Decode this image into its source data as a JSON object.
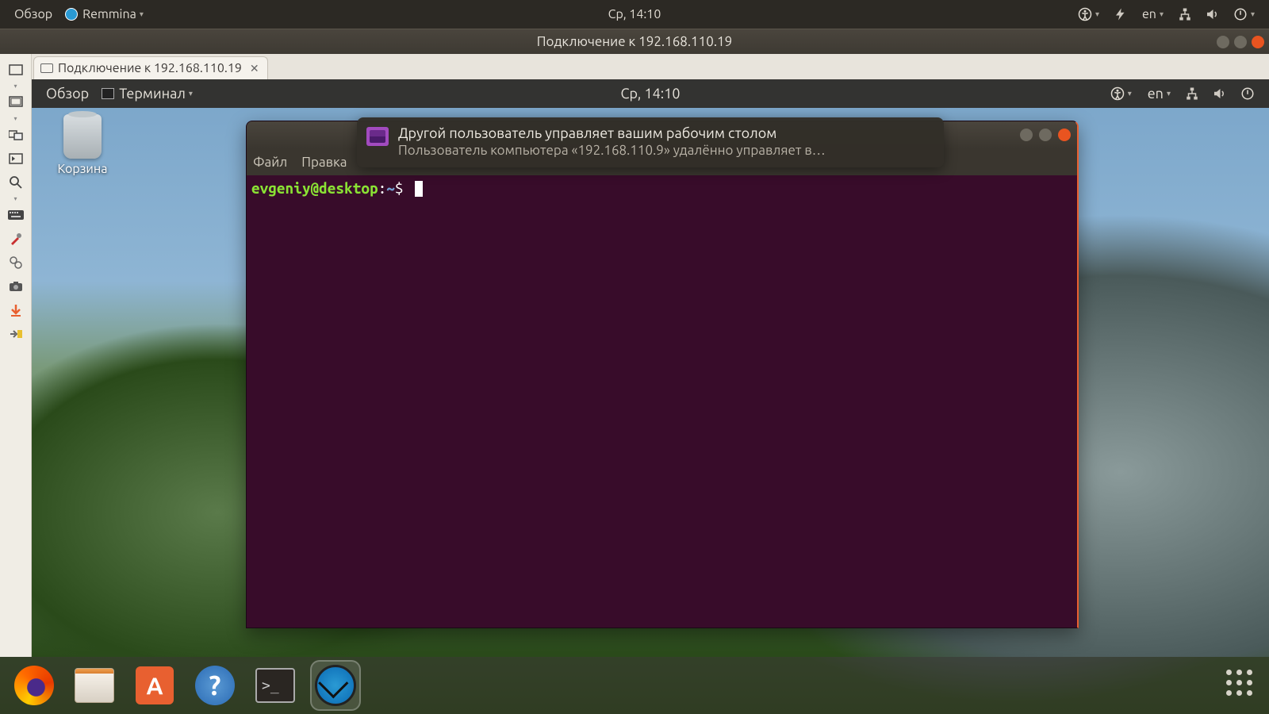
{
  "outer_panel": {
    "activities": "Обзор",
    "app_name": "Remmina",
    "clock": "Ср, 14:10",
    "lang": "en"
  },
  "window": {
    "title": "Подключение к 192.168.110.19",
    "tab_label": "Подключение к 192.168.110.19"
  },
  "remote": {
    "panel": {
      "activities": "Обзор",
      "app_name": "Терминал",
      "clock": "Ср, 14:10",
      "lang": "en"
    },
    "trash_label": "Корзина",
    "terminal": {
      "menus": {
        "file": "Файл",
        "edit": "Правка"
      },
      "prompt_user": "evgeniy@desktop",
      "prompt_path": "~",
      "prompt_symbol": "$"
    },
    "notification": {
      "title": "Другой пользователь управляет вашим рабочим столом",
      "body": "Пользователь компьютера «192.168.110.9» удалённо управляет в…"
    }
  }
}
